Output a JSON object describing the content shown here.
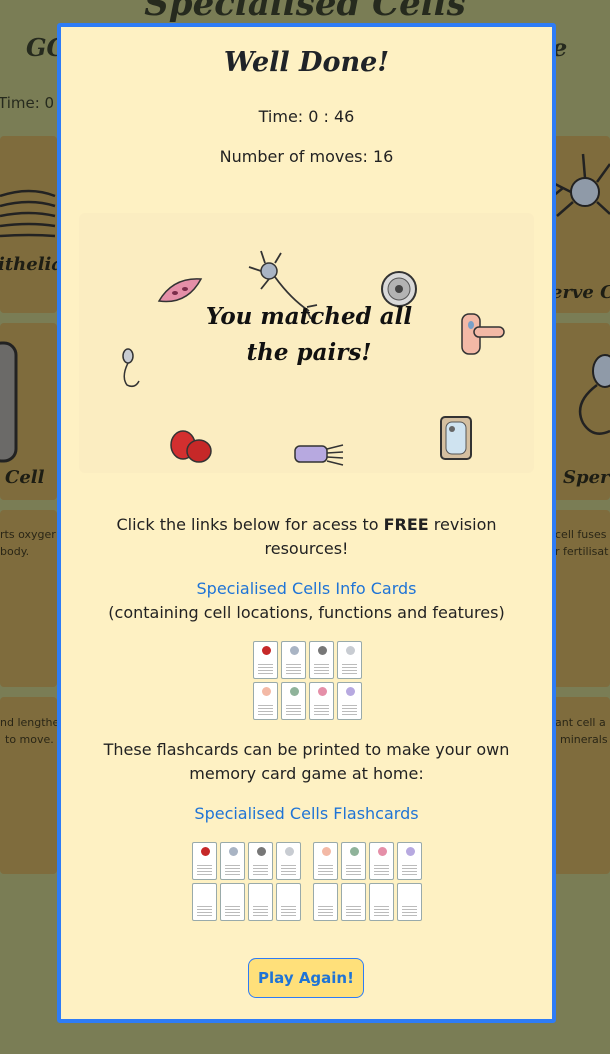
{
  "background": {
    "title": "Specialised Cells",
    "subtitle_left": "GC",
    "subtitle_right": "e",
    "time_label": "Time: 0",
    "cards": [
      {
        "label": "ithelia"
      },
      {
        "label": "erve C"
      },
      {
        "label": "Cell"
      },
      {
        "label": "Sperm"
      }
    ],
    "side_texts": [
      "rts oxyger",
      "body.",
      "cell fuses",
      "r fertilisat",
      "nd lengthe",
      "to move.",
      "ant cell a",
      "minerals"
    ]
  },
  "modal": {
    "title": "Well Done!",
    "time": "Time: 0 : 46",
    "moves": "Number of moves: 16",
    "celebration": "You matched all the pairs!",
    "intro_before": "Click the links below for acess to ",
    "intro_bold": "FREE",
    "intro_after": " revision resources!",
    "info_link": "Specialised Cells Info Cards",
    "info_desc": "(containing cell locations, functions and features)",
    "flash_desc": "These flashcards can be printed to make your own memory card game at home:",
    "flash_link": "Specialised Cells Flashcards",
    "play_again": "Play Again!"
  },
  "colors": {
    "modal_border": "#2e7cf6",
    "modal_bg": "#fef1c3",
    "link": "#1f74d6",
    "button_bg": "#ffe07a"
  }
}
